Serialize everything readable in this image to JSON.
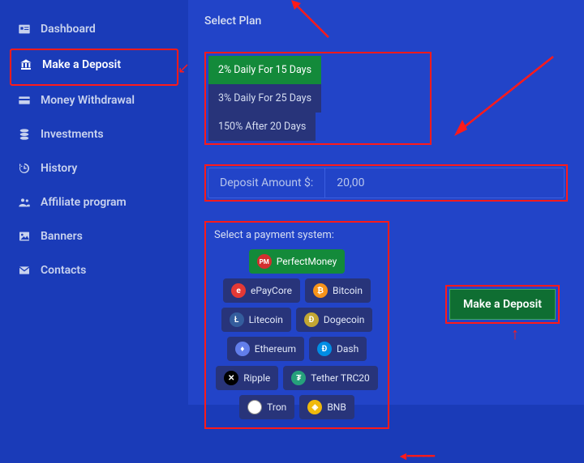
{
  "sidebar": {
    "items": [
      {
        "label": "Dashboard"
      },
      {
        "label": "Make a Deposit"
      },
      {
        "label": "Money Withdrawal"
      },
      {
        "label": "Investments"
      },
      {
        "label": "History"
      },
      {
        "label": "Affiliate program"
      },
      {
        "label": "Banners"
      },
      {
        "label": "Contacts"
      }
    ]
  },
  "main": {
    "select_plan_label": "Select Plan",
    "plans": [
      {
        "label": "2% Daily For 15 Days",
        "active": true
      },
      {
        "label": "3% Daily For 25 Days"
      },
      {
        "label": "150% After 20 Days"
      }
    ],
    "deposit": {
      "label": "Deposit Amount $:",
      "value": "20,00"
    },
    "payment": {
      "title": "Select a payment system:",
      "options": [
        {
          "label": "PerfectMoney",
          "icon": "PM",
          "cls": "c-pm",
          "active": true
        },
        {
          "label": "ePayCore",
          "icon": "e",
          "cls": "c-epay"
        },
        {
          "label": "Bitcoin",
          "icon": "₿",
          "cls": "c-btc"
        },
        {
          "label": "Litecoin",
          "icon": "Ł",
          "cls": "c-ltc"
        },
        {
          "label": "Dogecoin",
          "icon": "Ð",
          "cls": "c-doge"
        },
        {
          "label": "Ethereum",
          "icon": "♦",
          "cls": "c-eth"
        },
        {
          "label": "Dash",
          "icon": "Đ",
          "cls": "c-dash"
        },
        {
          "label": "Ripple",
          "icon": "✕",
          "cls": "c-xrp"
        },
        {
          "label": "Tether TRC20",
          "icon": "₮",
          "cls": "c-usdt"
        },
        {
          "label": "Tron",
          "icon": "",
          "cls": "c-tron"
        },
        {
          "label": "BNB",
          "icon": "◈",
          "cls": "c-bnb"
        }
      ]
    },
    "submit_label": "Make a Deposit"
  }
}
